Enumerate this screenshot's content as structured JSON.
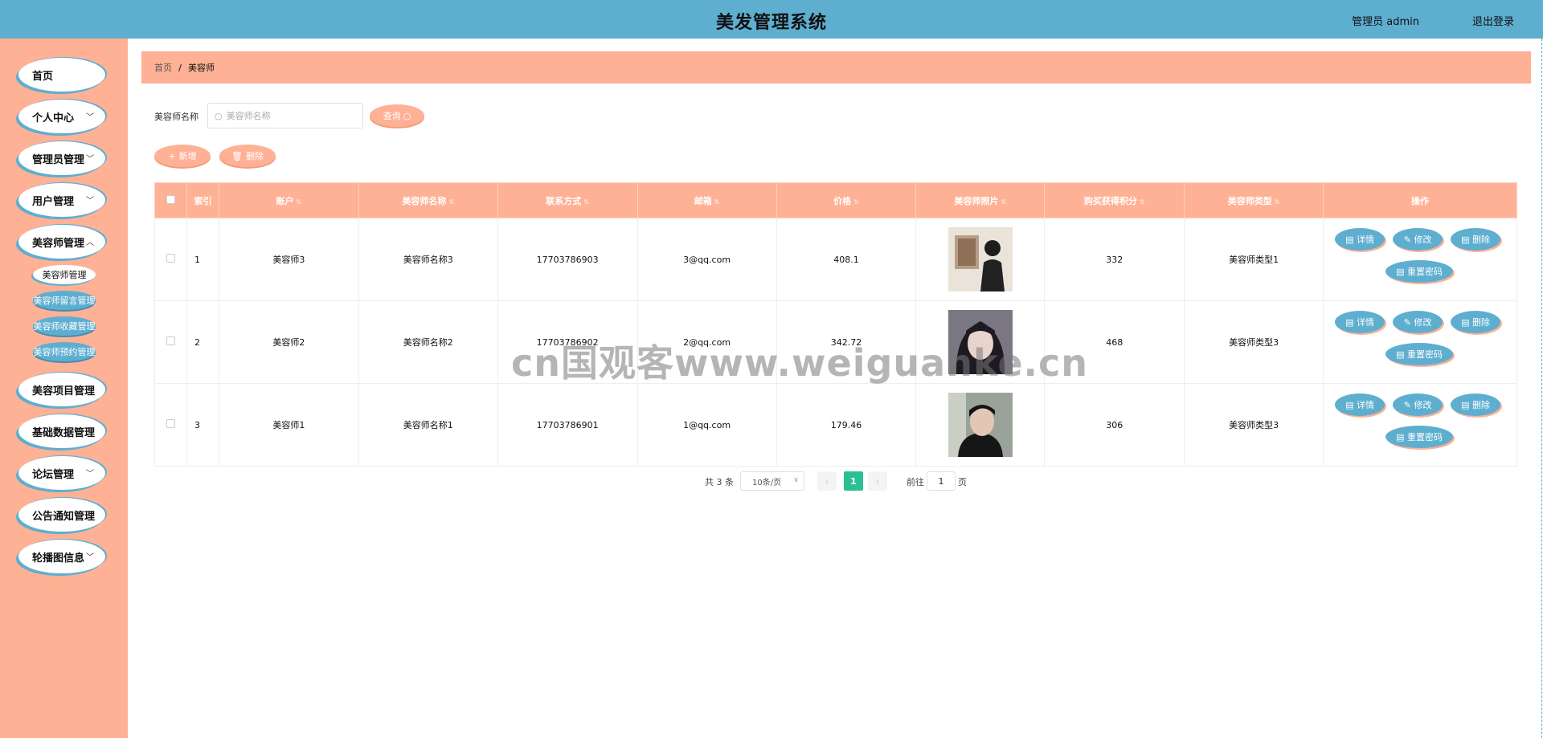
{
  "header": {
    "title": "美发管理系统",
    "user_label": "管理员 admin",
    "logout_label": "退出登录"
  },
  "sidebar": {
    "items": [
      {
        "label": "首页",
        "has_chevron": false
      },
      {
        "label": "个人中心",
        "has_chevron": true
      },
      {
        "label": "管理员管理",
        "has_chevron": true
      },
      {
        "label": "用户管理",
        "has_chevron": true
      },
      {
        "label": "美容师管理",
        "has_chevron": true
      },
      {
        "label": "美容项目管理",
        "has_chevron": true
      },
      {
        "label": "基础数据管理",
        "has_chevron": true
      },
      {
        "label": "论坛管理",
        "has_chevron": true
      },
      {
        "label": "公告通知管理",
        "has_chevron": true
      },
      {
        "label": "轮播图信息",
        "has_chevron": true
      }
    ],
    "sub_items": [
      {
        "label": "美容师管理",
        "active": true
      },
      {
        "label": "美容师留言管理",
        "active": false
      },
      {
        "label": "美容师收藏管理",
        "active": false
      },
      {
        "label": "美容师预约管理",
        "active": false
      }
    ]
  },
  "breadcrumb": {
    "home": "首页",
    "separator": "/",
    "current": "美容师"
  },
  "search": {
    "label": "美容师名称",
    "placeholder": "美容师名称",
    "query_button": "查询"
  },
  "actions": {
    "add_label": "新增",
    "delete_label": "删除"
  },
  "table": {
    "columns": [
      "",
      "索引",
      "账户",
      "美容师名称",
      "联系方式",
      "邮箱",
      "价格",
      "美容师照片",
      "购买获得积分",
      "美容师类型",
      "操作"
    ],
    "rows": [
      {
        "index": "1",
        "account": "美容师3",
        "name": "美容师名称3",
        "phone": "17703786903",
        "email": "3@qq.com",
        "price": "408.1",
        "photo": "photo-1",
        "points": "332",
        "type": "美容师类型1"
      },
      {
        "index": "2",
        "account": "美容师2",
        "name": "美容师名称2",
        "phone": "17703786902",
        "email": "2@qq.com",
        "price": "342.72",
        "photo": "photo-2",
        "points": "468",
        "type": "美容师类型3"
      },
      {
        "index": "3",
        "account": "美容师1",
        "name": "美容师名称1",
        "phone": "17703786901",
        "email": "1@qq.com",
        "price": "179.46",
        "photo": "photo-3",
        "points": "306",
        "type": "美容师类型3"
      }
    ],
    "row_actions": {
      "detail": "详情",
      "edit": "修改",
      "delete": "删除",
      "reset_password": "重置密码"
    }
  },
  "pagination": {
    "total_text": "共 3 条",
    "page_size": "10条/页",
    "current_page": "1",
    "goto_label": "前往",
    "goto_value": "1",
    "page_suffix": "页"
  },
  "watermark": "cn国观客www.weiguanke.cn",
  "colors": {
    "header_bg": "#5eaed0",
    "sidebar_bg": "#ffb195",
    "accent_salmon": "#ffb195",
    "accent_blue": "#5eaed0",
    "pager_active": "#2bbf96"
  }
}
